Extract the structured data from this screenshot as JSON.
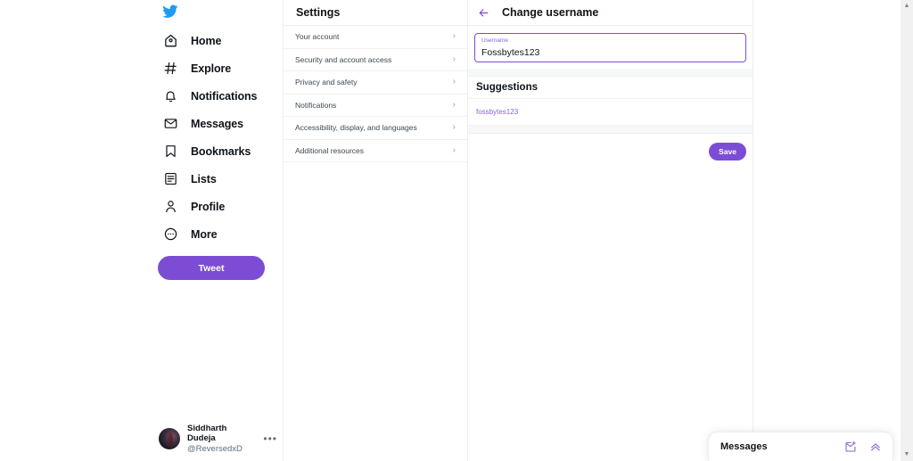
{
  "colors": {
    "brand_purple": "#7c4dd4",
    "link_purple": "#8a63d2",
    "twitter_blue": "#1d9bf0",
    "text_primary": "#0f1419",
    "text_secondary": "#5b7083",
    "divider": "#ebeef0",
    "band_gray": "#f7f8f9"
  },
  "sidebar": {
    "logo_icon": "twitter-bird-icon",
    "items": [
      {
        "label": "Home",
        "icon": "home-icon"
      },
      {
        "label": "Explore",
        "icon": "hashtag-icon"
      },
      {
        "label": "Notifications",
        "icon": "bell-icon"
      },
      {
        "label": "Messages",
        "icon": "envelope-icon"
      },
      {
        "label": "Bookmarks",
        "icon": "bookmark-icon"
      },
      {
        "label": "Lists",
        "icon": "list-icon"
      },
      {
        "label": "Profile",
        "icon": "person-icon"
      },
      {
        "label": "More",
        "icon": "more-circle-icon"
      }
    ],
    "tweet_button": "Tweet",
    "account": {
      "name": "Siddharth Dudeja",
      "handle": "@ReversedxD",
      "more_glyph": "•••",
      "avatar_icon": "user-avatar"
    }
  },
  "settings": {
    "title": "Settings",
    "rows": [
      {
        "label": "Your account"
      },
      {
        "label": "Security and account access"
      },
      {
        "label": "Privacy and safety"
      },
      {
        "label": "Notifications"
      },
      {
        "label": "Accessibility, display, and languages"
      },
      {
        "label": "Additional resources"
      }
    ],
    "chevron_glyph": "›"
  },
  "detail": {
    "title": "Change username",
    "back_icon": "arrow-left-icon",
    "username_field": {
      "label": "Username",
      "value": "Fossbytes123",
      "placeholder": "Username"
    },
    "suggestions_title": "Suggestions",
    "suggestions": [
      {
        "label": "fossbytes123"
      }
    ],
    "save_label": "Save"
  },
  "messages_dock": {
    "title": "Messages",
    "new_message_icon": "new-message-icon",
    "collapse_icon": "chevron-double-up-icon"
  }
}
